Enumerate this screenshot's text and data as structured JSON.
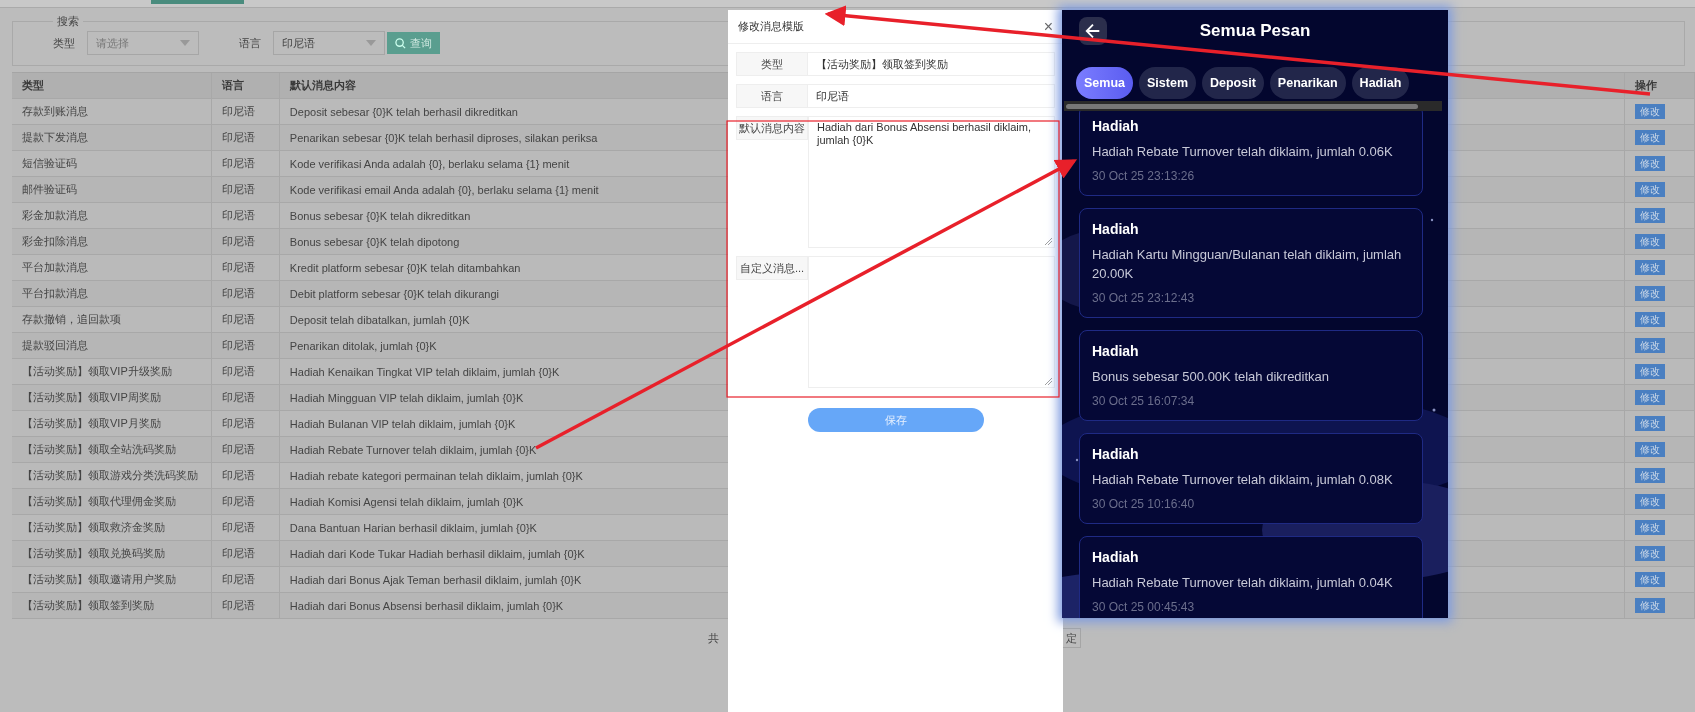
{
  "search": {
    "legend": "搜索",
    "fields": [
      {
        "label": "类型",
        "placeholder": "请选择"
      },
      {
        "label": "语言",
        "value": "印尼语"
      }
    ],
    "button": "查询"
  },
  "table": {
    "columns": [
      "类型",
      "语言",
      "默认消息内容",
      "操作"
    ],
    "rows": [
      {
        "type": "存款到账消息",
        "language": "印尼语",
        "content": "Deposit sebesar {0}K telah berhasil dikreditkan",
        "action": "修改"
      },
      {
        "type": "提款下发消息",
        "language": "印尼语",
        "content": "Penarikan sebesar {0}K telah berhasil diproses, silakan periksa",
        "action": "修改"
      },
      {
        "type": "短信验证码",
        "language": "印尼语",
        "content": "Kode verifikasi Anda adalah {0}, berlaku selama {1} menit",
        "action": "修改"
      },
      {
        "type": "邮件验证码",
        "language": "印尼语",
        "content": "Kode verifikasi email Anda adalah {0}, berlaku selama {1} menit",
        "action": "修改"
      },
      {
        "type": "彩金加款消息",
        "language": "印尼语",
        "content": "Bonus sebesar {0}K telah dikreditkan",
        "action": "修改"
      },
      {
        "type": "彩金扣除消息",
        "language": "印尼语",
        "content": "Bonus sebesar {0}K telah dipotong",
        "action": "修改"
      },
      {
        "type": "平台加款消息",
        "language": "印尼语",
        "content": "Kredit platform sebesar {0}K telah ditambahkan",
        "action": "修改"
      },
      {
        "type": "平台扣款消息",
        "language": "印尼语",
        "content": "Debit platform sebesar {0}K telah dikurangi",
        "action": "修改"
      },
      {
        "type": "存款撤销，追回款项",
        "language": "印尼语",
        "content": "Deposit telah dibatalkan, jumlah {0}K",
        "action": "修改"
      },
      {
        "type": "提款驳回消息",
        "language": "印尼语",
        "content": "Penarikan ditolak, jumlah {0}K",
        "action": "修改"
      },
      {
        "type": "【活动奖励】领取VIP升级奖励",
        "language": "印尼语",
        "content": "Hadiah Kenaikan Tingkat VIP telah diklaim, jumlah {0}K",
        "action": "修改"
      },
      {
        "type": "【活动奖励】领取VIP周奖励",
        "language": "印尼语",
        "content": "Hadiah Mingguan VIP telah diklaim, jumlah {0}K",
        "action": "修改"
      },
      {
        "type": "【活动奖励】领取VIP月奖励",
        "language": "印尼语",
        "content": "Hadiah Bulanan VIP telah diklaim, jumlah {0}K",
        "action": "修改"
      },
      {
        "type": "【活动奖励】领取全站洗码奖励",
        "language": "印尼语",
        "content": "Hadiah Rebate Turnover telah diklaim, jumlah {0}K",
        "action": "修改"
      },
      {
        "type": "【活动奖励】领取游戏分类洗码奖励",
        "language": "印尼语",
        "content": "Hadiah rebate kategori permainan telah diklaim, jumlah {0}K",
        "action": "修改"
      },
      {
        "type": "【活动奖励】领取代理佣金奖励",
        "language": "印尼语",
        "content": "Hadiah Komisi Agensi telah diklaim, jumlah {0}K",
        "action": "修改"
      },
      {
        "type": "【活动奖励】领取救济金奖励",
        "language": "印尼语",
        "content": "Dana Bantuan Harian berhasil diklaim, jumlah {0}K",
        "action": "修改"
      },
      {
        "type": "【活动奖励】领取兑换码奖励",
        "language": "印尼语",
        "content": "Hadiah dari Kode Tukar Hadiah berhasil diklaim, jumlah {0}K",
        "action": "修改"
      },
      {
        "type": "【活动奖励】领取邀请用户奖励",
        "language": "印尼语",
        "content": "Hadiah dari Bonus Ajak Teman berhasil diklaim, jumlah {0}K",
        "action": "修改"
      },
      {
        "type": "【活动奖励】领取签到奖励",
        "language": "印尼语",
        "content": "Hadiah dari Bonus Absensi berhasil diklaim, jumlah {0}K",
        "action": "修改"
      }
    ]
  },
  "pagination": {
    "summary": "共",
    "confirm": "定"
  },
  "dialog": {
    "title": "修改消息模版",
    "close": "×",
    "fields": [
      {
        "kind": "text",
        "label": "类型",
        "value": "【活动奖励】领取签到奖励"
      },
      {
        "kind": "text",
        "label": "语言",
        "value": "印尼语"
      },
      {
        "kind": "textarea",
        "label": "默认消息内容",
        "value": "Hadiah dari Bonus Absensi berhasil diklaim, jumlah {0}K"
      },
      {
        "kind": "textarea",
        "label": "自定义消息..."
      }
    ],
    "save": "保存"
  },
  "phone": {
    "title": "Semua Pesan",
    "tabs": [
      {
        "label": "Semua",
        "selected": true
      },
      {
        "label": "Sistem",
        "selected": false
      },
      {
        "label": "Deposit",
        "selected": false
      },
      {
        "label": "Penarikan",
        "selected": false
      },
      {
        "label": "Hadiah",
        "selected": false
      }
    ],
    "messages": [
      {
        "title": "Hadiah",
        "body": "Hadiah Rebate Turnover telah diklaim, jumlah 0.06K",
        "time": "30 Oct 25 23:13:26"
      },
      {
        "title": "Hadiah",
        "body": "Hadiah Kartu Mingguan/Bulanan telah diklaim, jumlah 20.00K",
        "time": "30 Oct 25 23:12:43"
      },
      {
        "title": "Hadiah",
        "body": "Bonus sebesar 500.00K telah dikreditkan",
        "time": "30 Oct 25 16:07:34"
      },
      {
        "title": "Hadiah",
        "body": "Hadiah Rebate Turnover telah diklaim, jumlah 0.08K",
        "time": "30 Oct 25 10:16:40"
      },
      {
        "title": "Hadiah",
        "body": "Hadiah Rebate Turnover telah diklaim, jumlah 0.04K",
        "time": "30 Oct 25 00:45:43"
      }
    ]
  }
}
